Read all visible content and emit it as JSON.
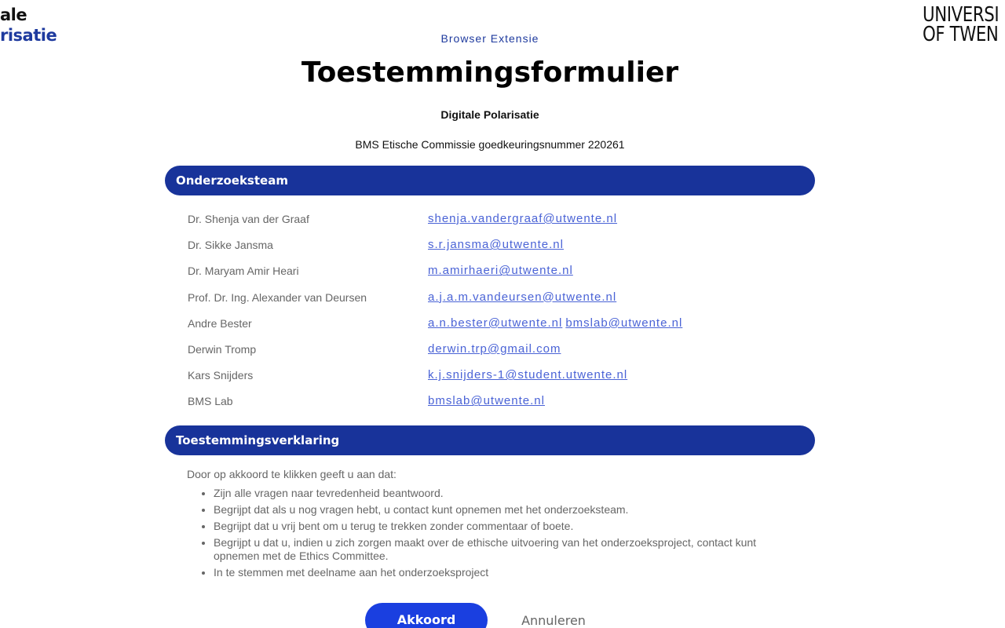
{
  "logos": {
    "left_line1": "ale",
    "left_line2": "risatie",
    "right_line1": "UNIVERSI",
    "right_line2": "OF TWEN"
  },
  "header": {
    "subtitle": "Browser Extensie",
    "title": "Toestemmingsformulier",
    "project": "Digitale Polarisatie",
    "approval": "BMS Etische Commissie goedkeuringsnummer 220261"
  },
  "team_section": {
    "heading": "Onderzoeksteam",
    "members": [
      {
        "name": "Dr. Shenja van der Graaf",
        "emails": [
          "shenja.vandergraaf@utwente.nl"
        ]
      },
      {
        "name": "Dr. Sikke Jansma",
        "emails": [
          "s.r.jansma@utwente.nl"
        ]
      },
      {
        "name": "Dr. Maryam Amir Heari",
        "emails": [
          "m.amirhaeri@utwente.nl"
        ]
      },
      {
        "name": "Prof. Dr. Ing. Alexander van Deursen",
        "emails": [
          "a.j.a.m.vandeursen@utwente.nl"
        ]
      },
      {
        "name": "Andre Bester",
        "emails": [
          "a.n.bester@utwente.nl",
          "bmslab@utwente.nl"
        ]
      },
      {
        "name": "Derwin Tromp",
        "emails": [
          "derwin.trp@gmail.com"
        ]
      },
      {
        "name": "Kars Snijders",
        "emails": [
          "k.j.snijders-1@student.utwente.nl"
        ]
      },
      {
        "name": "BMS Lab",
        "emails": [
          "bmslab@utwente.nl"
        ]
      }
    ]
  },
  "consent_section": {
    "heading": "Toestemmingsverklaring",
    "intro": "Door op akkoord te klikken geeft u aan dat:",
    "items": [
      "Zijn alle vragen naar tevredenheid beantwoord.",
      "Begrijpt dat als u nog vragen hebt, u contact kunt opnemen met het onderzoeksteam.",
      "Begrijpt dat u vrij bent om u terug te trekken zonder commentaar of boete.",
      "Begrijpt u dat u, indien u zich zorgen maakt over de ethische uitvoering van het onderzoeksproject, contact kunt opnemen met de Ethics Committee.",
      "In te stemmen met deelname aan het onderzoeksproject"
    ]
  },
  "actions": {
    "accept_label": "Akkoord",
    "cancel_label": "Annuleren"
  },
  "colors": {
    "brand_blue": "#18339a",
    "button_blue": "#1a3fe0",
    "link_blue": "#4a63d6"
  }
}
